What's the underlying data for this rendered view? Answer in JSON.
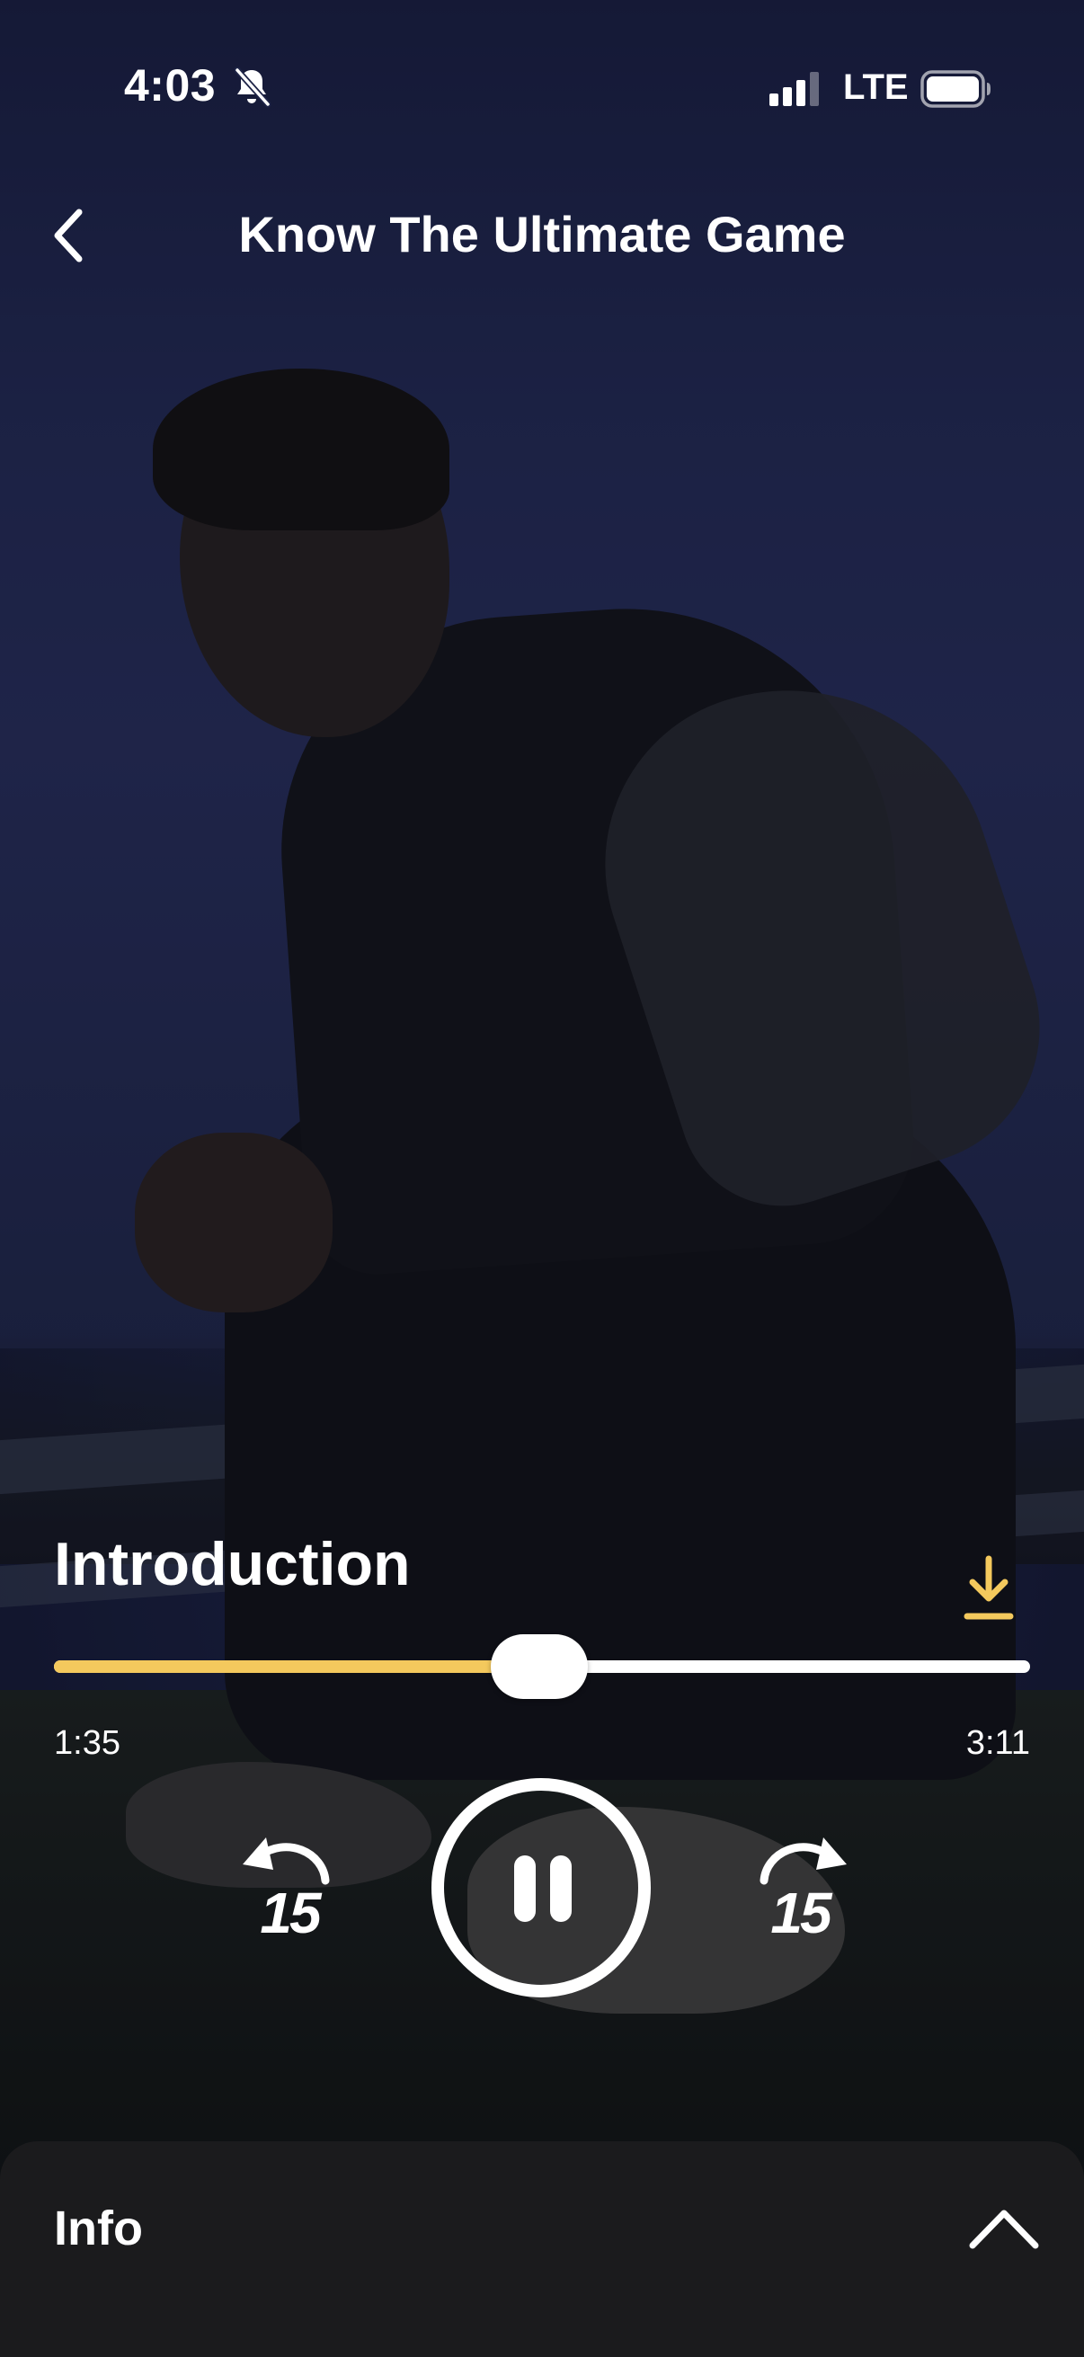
{
  "status_bar": {
    "time": "4:03",
    "network": "LTE",
    "icons": [
      "bell-slash-icon",
      "signal-icon",
      "battery-icon"
    ]
  },
  "header": {
    "title": "Know The Ultimate Game",
    "back_icon": "chevron-left-icon"
  },
  "track": {
    "title": "Introduction",
    "download_icon": "download-icon"
  },
  "progress": {
    "elapsed": "1:35",
    "total": "3:11",
    "fraction": 0.497
  },
  "controls": {
    "rewind_seconds": "15",
    "forward_seconds": "15",
    "state": "playing",
    "rewind_icon": "rewind-15-icon",
    "pause_icon": "pause-icon",
    "forward_icon": "forward-15-icon"
  },
  "info_panel": {
    "title": "Info",
    "toggle_icon": "chevron-up-icon"
  },
  "colors": {
    "accent": "#f4c95d",
    "panel": "#1b1b1d",
    "text": "#ffffff"
  }
}
